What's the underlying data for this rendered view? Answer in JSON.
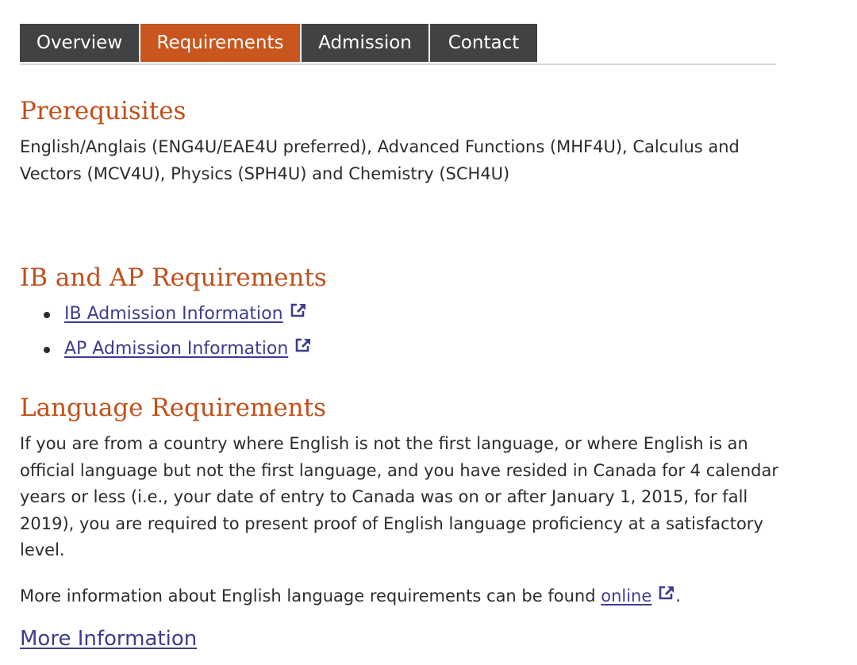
{
  "tabs": [
    {
      "label": "Overview",
      "active": false
    },
    {
      "label": "Requirements",
      "active": true
    },
    {
      "label": "Admission",
      "active": false
    },
    {
      "label": "Contact",
      "active": false
    }
  ],
  "prerequisites": {
    "heading": "Prerequisites",
    "text": "English/Anglais (ENG4U/EAE4U preferred), Advanced Functions (MHF4U), Calculus and Vectors (MCV4U), Physics (SPH4U) and Chemistry (SCH4U)"
  },
  "ib_ap": {
    "heading": "IB and AP Requirements",
    "links": [
      {
        "label": "IB Admission Information",
        "icon": "external-link-icon"
      },
      {
        "label": "AP Admission Information",
        "icon": "external-link-icon"
      }
    ]
  },
  "language": {
    "heading": "Language Requirements",
    "text": "If you are from a country where English is not the first language, or where English is an official language but not the first language, and you have resided in Canada for 4 calendar years or less (i.e., your date of entry to Canada was on or after January 1, 2015, for fall 2019), you are required to present proof of English language proficiency at a satisfactory level.",
    "more_prefix": "More information about English language requirements can be found ",
    "more_link": "online",
    "more_suffix": "."
  },
  "more_information_link": "More Information",
  "colors": {
    "accent": "#c8561e",
    "tab_dark": "#404244",
    "heading": "#c0501a",
    "link": "#3d3d8f",
    "text": "#2b2b2b"
  }
}
